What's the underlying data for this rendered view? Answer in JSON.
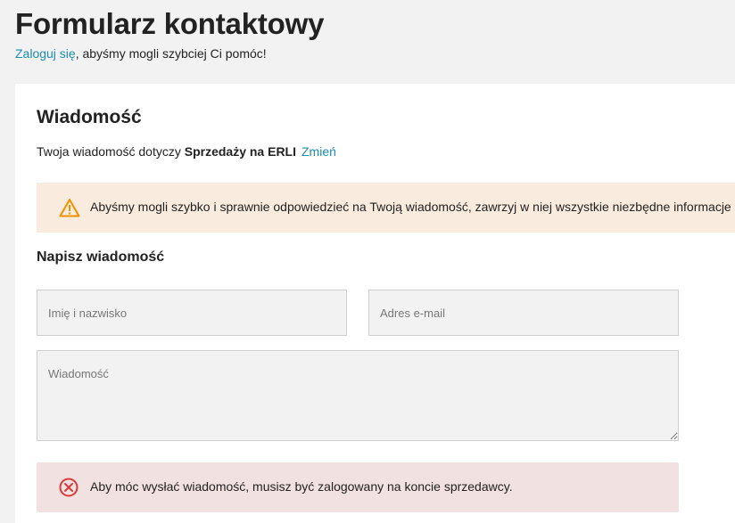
{
  "header": {
    "title": "Formularz kontaktowy",
    "login_link": "Zaloguj się",
    "login_suffix": ", abyśmy mogli szybciej Ci pomóc!"
  },
  "message_section": {
    "title": "Wiadomość",
    "topic_prefix": "Twoja wiadomość dotyczy ",
    "topic_value": "Sprzedaży na ERLI",
    "change_link": "Zmień"
  },
  "warning": {
    "icon": "warning-triangle-icon",
    "color": "#f39200",
    "text": "Abyśmy mogli szybko i sprawnie odpowiedzieć na Twoją wiadomość, zawrzyj w niej wszystkie niezbędne informacje"
  },
  "form": {
    "title": "Napisz wiadomość",
    "name_placeholder": "Imię i nazwisko",
    "name_value": "",
    "email_placeholder": "Adres e-mail",
    "email_value": "",
    "message_placeholder": "Wiadomość",
    "message_value": ""
  },
  "error": {
    "icon": "error-circle-x-icon",
    "color": "#d93a3a",
    "text": "Aby móc wysłać wiadomość, musisz być zalogowany na koncie sprzedawcy."
  },
  "colors": {
    "link": "#1c8cb0",
    "warning_bg": "#f9ebdd",
    "error_bg": "#f1e1e0",
    "page_bg": "#f2f2f2"
  }
}
